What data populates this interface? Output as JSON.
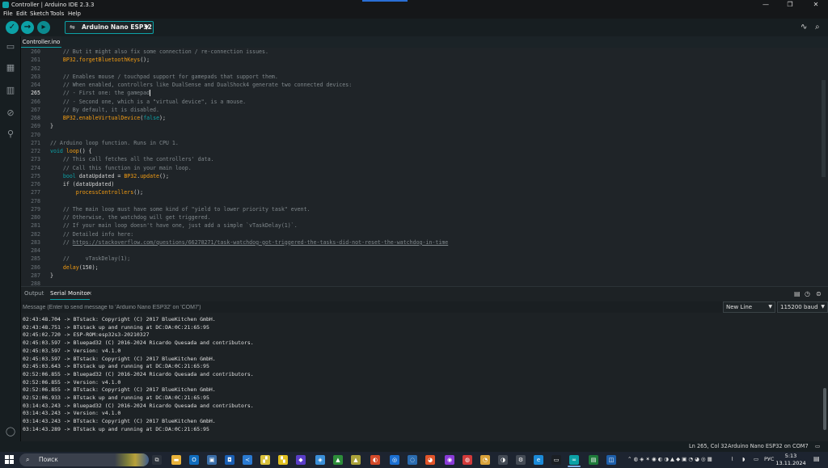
{
  "window": {
    "title": "Controller | Arduino IDE 2.3.3",
    "minimize": "—",
    "maximize": "❐",
    "close": "✕"
  },
  "menu": [
    "File",
    "Edit",
    "Sketch",
    "Tools",
    "Help"
  ],
  "toolbar": {
    "verify_icon": "check-icon",
    "upload_icon": "arrow-right-icon",
    "debug_icon": "debug-icon",
    "board": "Arduino Nano ESP32",
    "plotter_icon": "serial-plotter-icon",
    "monitor_icon": "serial-monitor-icon"
  },
  "sidebar": [
    "folder-icon",
    "boards-manager-icon",
    "library-manager-icon",
    "debug-icon",
    "search-icon",
    "account-icon"
  ],
  "editor": {
    "tab": "Controller.ino",
    "active_line": 265,
    "lines": [
      {
        "n": "260",
        "seg": [
          [
            "    // But it might also fix some connection / re-connection issues.",
            "c-com"
          ]
        ]
      },
      {
        "n": "261",
        "seg": [
          [
            "    ",
            ""
          ],
          [
            "BP32",
            "c-fn"
          ],
          [
            ".",
            ""
          ],
          [
            "forgetBluetoothKeys",
            "c-fn"
          ],
          [
            "();",
            ""
          ]
        ]
      },
      {
        "n": "262",
        "seg": []
      },
      {
        "n": "263",
        "seg": [
          [
            "    // Enables mouse / touchpad support for gamepads that support them.",
            "c-com"
          ]
        ]
      },
      {
        "n": "264",
        "seg": [
          [
            "    // When enabled, controllers like DualSense and DualShock4 generate two connected devices:",
            "c-com"
          ]
        ]
      },
      {
        "n": "265",
        "seg": [
          [
            "    // - First one: the gamepad",
            "c-com"
          ]
        ]
      },
      {
        "n": "266",
        "seg": [
          [
            "    // - Second one, which is a \"virtual device\", is a mouse.",
            "c-com"
          ]
        ]
      },
      {
        "n": "267",
        "seg": [
          [
            "    // By default, it is disabled.",
            "c-com"
          ]
        ]
      },
      {
        "n": "268",
        "seg": [
          [
            "    ",
            ""
          ],
          [
            "BP32",
            "c-fn"
          ],
          [
            ".",
            ""
          ],
          [
            "enableVirtualDevice",
            "c-fn"
          ],
          [
            "(",
            ""
          ],
          [
            "false",
            "c-kw"
          ],
          [
            ");",
            ""
          ]
        ]
      },
      {
        "n": "269",
        "seg": [
          [
            "}",
            ""
          ]
        ]
      },
      {
        "n": "270",
        "seg": []
      },
      {
        "n": "271",
        "seg": [
          [
            "// Arduino loop function. Runs in CPU 1.",
            "c-com"
          ]
        ]
      },
      {
        "n": "272",
        "seg": [
          [
            "void",
            "c-kw"
          ],
          [
            " ",
            ""
          ],
          [
            "loop",
            "c-fn"
          ],
          [
            "() {",
            ""
          ]
        ]
      },
      {
        "n": "273",
        "seg": [
          [
            "    // This call fetches all the controllers' data.",
            "c-com"
          ]
        ]
      },
      {
        "n": "274",
        "seg": [
          [
            "    // Call this function in your main loop.",
            "c-com"
          ]
        ]
      },
      {
        "n": "275",
        "seg": [
          [
            "    ",
            ""
          ],
          [
            "bool",
            "c-kw"
          ],
          [
            " dataUpdated = ",
            ""
          ],
          [
            "BP32",
            "c-fn"
          ],
          [
            ".",
            ""
          ],
          [
            "update",
            "c-fn"
          ],
          [
            "();",
            ""
          ]
        ]
      },
      {
        "n": "276",
        "seg": [
          [
            "    if (dataUpdated)",
            ""
          ]
        ]
      },
      {
        "n": "277",
        "seg": [
          [
            "        ",
            ""
          ],
          [
            "processControllers",
            "c-fn"
          ],
          [
            "();",
            ""
          ]
        ]
      },
      {
        "n": "278",
        "seg": []
      },
      {
        "n": "279",
        "seg": [
          [
            "    // The main loop must have some kind of \"yield to lower priority task\" event.",
            "c-com"
          ]
        ]
      },
      {
        "n": "280",
        "seg": [
          [
            "    // Otherwise, the watchdog will get triggered.",
            "c-com"
          ]
        ]
      },
      {
        "n": "281",
        "seg": [
          [
            "    // If your main loop doesn't have one, just add a simple `vTaskDelay(1)`.",
            "c-com"
          ]
        ]
      },
      {
        "n": "282",
        "seg": [
          [
            "    // Detailed info here:",
            "c-com"
          ]
        ]
      },
      {
        "n": "283",
        "seg": [
          [
            "    // ",
            "c-com"
          ],
          [
            "https://stackoverflow.com/questions/66278271/task-watchdog-got-triggered-the-tasks-did-not-reset-the-watchdog-in-time",
            "c-link"
          ]
        ]
      },
      {
        "n": "284",
        "seg": []
      },
      {
        "n": "285",
        "seg": [
          [
            "    //     vTaskDelay(1);",
            "c-com"
          ]
        ]
      },
      {
        "n": "286",
        "seg": [
          [
            "    ",
            ""
          ],
          [
            "delay",
            "c-fn"
          ],
          [
            "(150);",
            ""
          ]
        ]
      },
      {
        "n": "287",
        "seg": [
          [
            "}",
            ""
          ]
        ]
      },
      {
        "n": "288",
        "seg": []
      }
    ]
  },
  "panel": {
    "tabs": [
      "Output",
      "Serial Monitor"
    ],
    "close": "×",
    "input_placeholder": "Message (Enter to send message to 'Arduino Nano ESP32' on 'COM7')",
    "line_ending": "New Line",
    "baud": "115200 baud",
    "log": [
      "02:43:48.704 -> BTstack: Copyright (C) 2017 BlueKitchen GmbH.",
      "02:43:48.751 -> BTstack up and running at DC:DA:0C:21:65:95",
      "02:45:02.720 -> ESP-ROM:esp32s3-20210327",
      "02:45:03.597 -> Bluepad32 (C) 2016-2024 Ricardo Quesada and contributors.",
      "02:45:03.597 -> Version: v4.1.0",
      "02:45:03.597 -> BTstack: Copyright (C) 2017 BlueKitchen GmbH.",
      "02:45:03.643 -> BTstack up and running at DC:DA:0C:21:65:95",
      "02:52:06.855 -> Bluepad32 (C) 2016-2024 Ricardo Quesada and contributors.",
      "02:52:06.855 -> Version: v4.1.0",
      "02:52:06.855 -> BTstack: Copyright (C) 2017 BlueKitchen GmbH.",
      "02:52:06.933 -> BTstack up and running at DC:DA:0C:21:65:95",
      "03:14:43.243 -> Bluepad32 (C) 2016-2024 Ricardo Quesada and contributors.",
      "03:14:43.243 -> Version: v4.1.0",
      "03:14:43.243 -> BTstack: Copyright (C) 2017 BlueKitchen GmbH.",
      "03:14:43.289 -> BTstack up and running at DC:DA:0C:21:65:95"
    ]
  },
  "status": {
    "cursor": "Ln 265, Col 32",
    "board_port": "Arduino Nano ESP32 on COM7"
  },
  "taskbar": {
    "search": "Поиск",
    "lang": "РУС",
    "time": "5:13",
    "date": "13.11.2024"
  }
}
